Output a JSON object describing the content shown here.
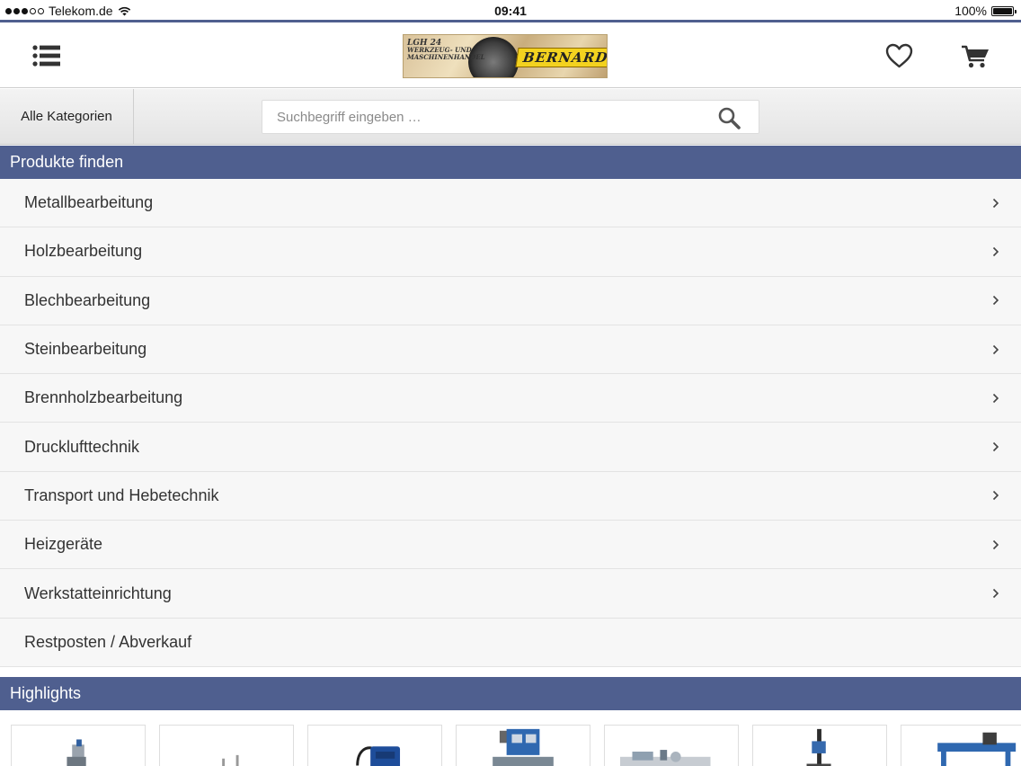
{
  "status_bar": {
    "carrier": "Telekom.de",
    "time": "09:41",
    "battery": "100%"
  },
  "header": {
    "logo": {
      "left_line1": "LGH 24",
      "left_line2": "WERKZEUG- UND",
      "left_line3": "MASCHINENHANDEL",
      "name": "BERNARDO"
    },
    "icons": [
      "menu-icon",
      "heart-icon",
      "cart-icon"
    ]
  },
  "search": {
    "all_categories_label": "Alle Kategorien",
    "placeholder": "Suchbegriff eingeben …",
    "value": ""
  },
  "products_section": {
    "title": "Produkte finden",
    "categories": [
      {
        "label": "Metallbearbeitung",
        "has_arrow": true
      },
      {
        "label": "Holzbearbeitung",
        "has_arrow": true
      },
      {
        "label": "Blechbearbeitung",
        "has_arrow": true
      },
      {
        "label": "Steinbearbeitung",
        "has_arrow": true
      },
      {
        "label": "Brennholzbearbeitung",
        "has_arrow": true
      },
      {
        "label": "Drucklufttechnik",
        "has_arrow": true
      },
      {
        "label": "Transport und Hebetechnik",
        "has_arrow": true
      },
      {
        "label": "Heizgeräte",
        "has_arrow": true
      },
      {
        "label": "Werkstatteinrichtung",
        "has_arrow": true
      },
      {
        "label": "Restposten / Abverkauf",
        "has_arrow": false
      }
    ]
  },
  "highlights_section": {
    "title": "Highlights",
    "product_count": 7
  },
  "colors": {
    "accent": "#4f5f8f",
    "list_bg": "#f7f7f7",
    "text": "#333333"
  }
}
